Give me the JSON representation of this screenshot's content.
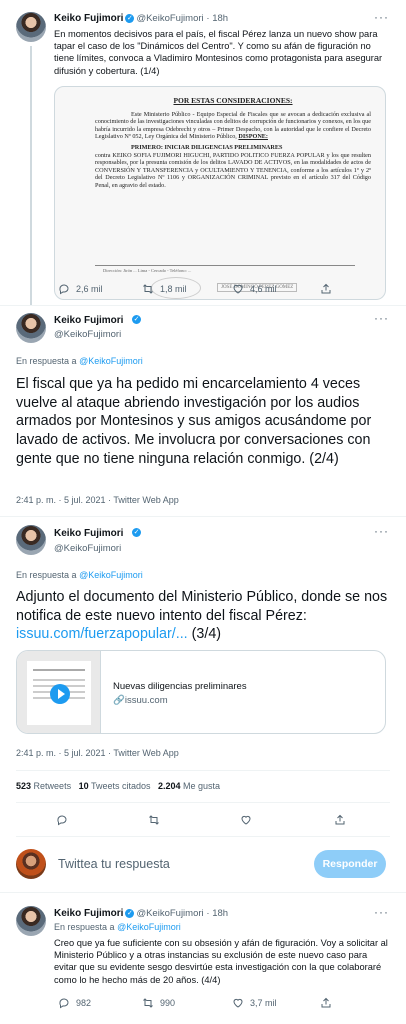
{
  "author": {
    "name": "Keiko Fujimori",
    "handle": "@KeikoFujimori",
    "verified_mark": "✓"
  },
  "tweet1": {
    "time": "· 18h",
    "text": "En momentos decisivos para el país, el fiscal Pérez lanza un nuevo show para tapar el caso de los \"Dinámicos del Centro\". Y como su afán de figuración no tiene límites, convoca a Vladimiro Montesinos como protagonista para asegurar difusión y cobertura. (1/4)",
    "doc": {
      "heading": "POR ESTAS CONSIDERACIONES:",
      "para1": "Este Ministerio Público - Equipo Especial de Fiscales que se avocan a dedicación exclusiva al conocimiento de las investigaciones vinculadas con delitos de corrupción de funcionarios y conexos, en los que habría incurrido la empresa Odebrecht y otros – Primer Despacho, con la autoridad que le confiere el Decreto Legislativo Nº 052, Ley Orgánica del Ministerio Público,",
      "dispone": "DISPONE:",
      "primero": "PRIMERO: INICIAR DILIGENCIAS PRELIMINARES",
      "para2": "contra KEIKO SOFIA FUJIMORI HIGUCHI, PARTIDO POLITICO FUERZA POPULAR y los que resulten responsables, por la presunta comisión de los delitos LAVADO DE ACTIVOS, en las modalidades de actos de CONVERSIÓN Y TRANSFERENCIA y OCULTAMIENTO Y TENENCIA, conforme a los artículos 1º y 2º del Decreto Legislativo Nº 1106 y ORGANIZACIÓN CRIMINAL previsto en el artículo 317 del Código Penal, en agravio del estado.",
      "footer": "Dirección: Jirón ... Lima - Cercado - Teléfono: ...",
      "signature": "JOSE DOMINGO PEREZ GOMEZ"
    },
    "replies": "2,6 mil",
    "retweets": "1,8 mil",
    "likes": "4,6 mil"
  },
  "tweet2": {
    "reply_prefix": "En respuesta a",
    "reply_to": "@KeikoFujimori",
    "text": "El fiscal que ya ha pedido mi encarcelamiento 4 veces vuelve al ataque abriendo investigación por los audios armados por Montesinos y sus amigos acusándome por lavado de activos. Me involucra por conversaciones con gente que no tiene ninguna relación conmigo. (2/4)",
    "meta": "2:41 p. m. · 5 jul. 2021 · Twitter Web App"
  },
  "tweet3": {
    "reply_prefix": "En respuesta a",
    "reply_to": "@KeikoFujimori",
    "text_before": "Adjunto el documento del Ministerio Público, donde se nos notifica de este nuevo intento del fiscal Pérez: ",
    "link": "issuu.com/fuerzapopular/...",
    "text_after": " (3/4)",
    "card_title": "Nuevas diligencias preliminares",
    "card_domain": "issuu.com",
    "meta": "2:41 p. m. · 5 jul. 2021 · Twitter Web App",
    "stats": {
      "retweets_count": "523",
      "retweets_label": "Retweets",
      "quotes_count": "10",
      "quotes_label": "Tweets citados",
      "likes_count": "2.204",
      "likes_label": "Me gusta"
    }
  },
  "composer": {
    "placeholder": "Twittea tu respuesta",
    "button": "Responder"
  },
  "tweet4": {
    "time": "· 18h",
    "reply_prefix": "En respuesta a",
    "reply_to": "@KeikoFujimori",
    "text": "Creo que ya fue suficiente con su obsesión y afán de figuración. Voy a solicitar al Ministerio Público y a otras instancias su exclusión de este nuevo caso para evitar que su evidente sesgo desvirtúe esta investigación con la que colaboraré como lo he hecho más de 20 años. (4/4)",
    "replies": "982",
    "retweets": "990",
    "likes": "3,7 mil"
  },
  "colors": {
    "accent": "#1d9bf0",
    "reply_button_disabled": "#8ecdf8",
    "muted_text": "#536471"
  },
  "icons": [
    "reply-icon",
    "retweet-icon",
    "like-icon",
    "share-icon",
    "play-icon",
    "link-icon",
    "more-icon",
    "verified-icon"
  ]
}
